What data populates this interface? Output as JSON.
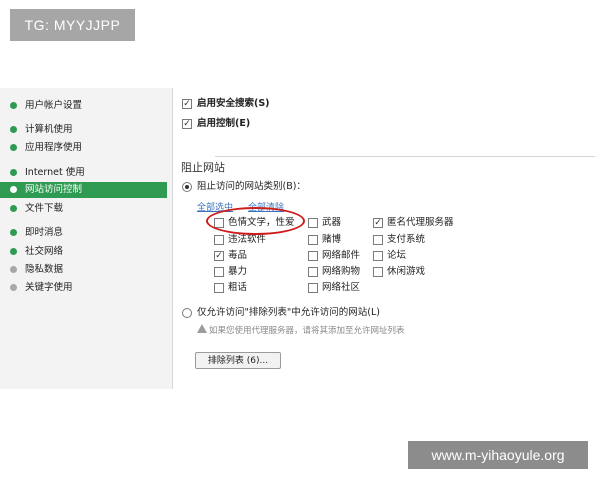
{
  "watermarks": {
    "top": "TG: MYYJJPP",
    "bottom": "www.m-yihaoyule.org"
  },
  "sidebar": {
    "items": [
      {
        "label": "用户帐户设置"
      },
      {
        "label": "计算机使用"
      },
      {
        "label": "应用程序使用"
      },
      {
        "label": "Internet 使用"
      },
      {
        "label": "网站访问控制"
      },
      {
        "label": "文件下载"
      },
      {
        "label": "即时消息"
      },
      {
        "label": "社交网络"
      },
      {
        "label": "隐私数据"
      },
      {
        "label": "关键字使用"
      }
    ]
  },
  "main": {
    "safe_search": {
      "label": "启用安全搜索(S)",
      "checked": true
    },
    "control": {
      "label": "启用控制(E)",
      "checked": true
    },
    "section_title": "阻止网站",
    "block_category_radio": "阻止访问的网站类别(B)：",
    "select_all": "全部选中",
    "clear_all": "全部清除",
    "categories": [
      {
        "label": "色情文学，性爱",
        "checked": false
      },
      {
        "label": "违法软件",
        "checked": false
      },
      {
        "label": "毒品",
        "checked": true
      },
      {
        "label": "暴力",
        "checked": false
      },
      {
        "label": "粗话",
        "checked": false
      },
      {
        "label": "武器",
        "checked": false
      },
      {
        "label": "赌博",
        "checked": false
      },
      {
        "label": "网络邮件",
        "checked": false
      },
      {
        "label": "网络购物",
        "checked": false
      },
      {
        "label": "网络社区",
        "checked": false
      },
      {
        "label": "匿名代理服务器",
        "checked": true
      },
      {
        "label": "支付系统",
        "checked": false
      },
      {
        "label": "论坛",
        "checked": false
      },
      {
        "label": "休闲游戏",
        "checked": false
      }
    ],
    "allow_list_radio": "仅允许访问\"排除列表\"中允许访问的网站(L)",
    "proxy_note": "如果您使用代理服务器，请将其添加至允许网址列表",
    "exclusion_button": "排除列表 (6)..."
  }
}
